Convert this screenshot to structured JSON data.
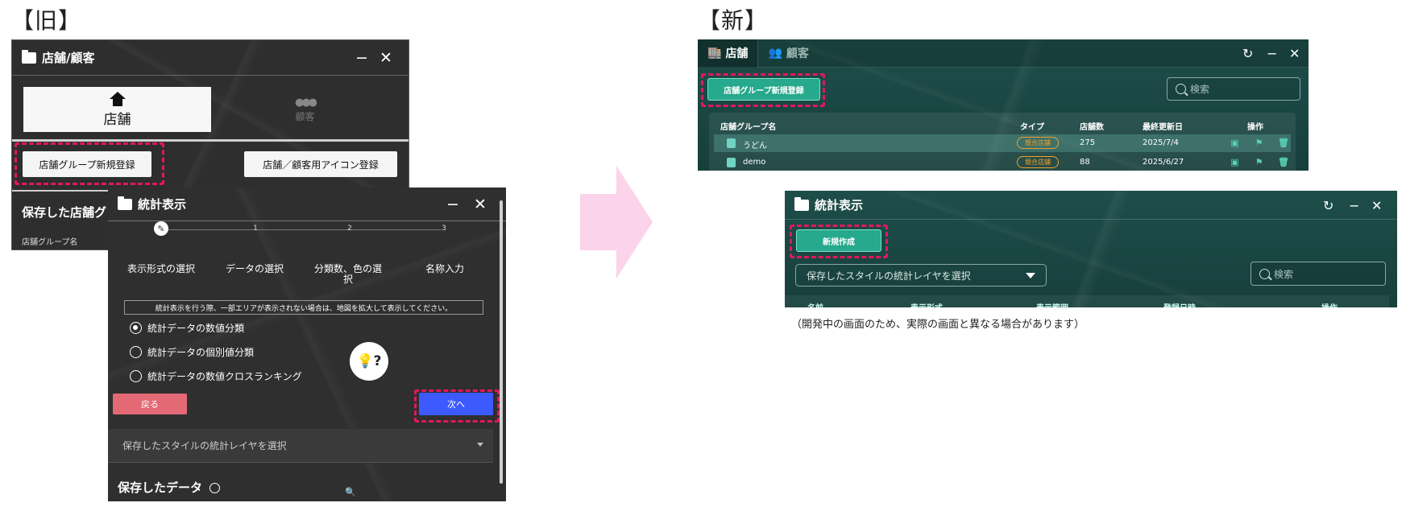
{
  "headings": {
    "old": "【旧】",
    "new": "【新】"
  },
  "old_shop": {
    "title": "店舗/顧客",
    "tabs": [
      {
        "label": "店舗",
        "icon": "house-icon"
      },
      {
        "label": "顧客",
        "icon": "people-icon"
      }
    ],
    "register_group_button": "店舗グループ新規登録",
    "icon_register_button": "店舗／顧客用アイコン登録",
    "saved_label": "保存した店舗グ",
    "group_name_small": "店舗グループ名"
  },
  "old_stats": {
    "title": "統計表示",
    "steps": [
      {
        "num": "",
        "label": "表示形式の選択",
        "done": true
      },
      {
        "num": "1",
        "label": "データの選択"
      },
      {
        "num": "2",
        "label": "分類数、色の選択"
      },
      {
        "num": "3",
        "label": "名称入力"
      }
    ],
    "notice": "統計表示を行う際、一部エリアが表示されない場合は、地図を拡大して表示してください。",
    "options": [
      {
        "label": "統計データの数値分類",
        "checked": true
      },
      {
        "label": "統計データの個別値分類",
        "checked": false
      },
      {
        "label": "統計データの数値クロスランキング",
        "checked": false
      }
    ],
    "back_button": "戻る",
    "next_button": "次へ",
    "saved_style_select": "保存したスタイルの統計レイヤを選択",
    "saved_data_label": "保存したデータ"
  },
  "new_shop": {
    "tabs": [
      {
        "label": "店舗"
      },
      {
        "label": "顧客"
      }
    ],
    "register_group_button": "店舗グループ新規登録",
    "search_placeholder": "検索",
    "columns": [
      "店舗グループ名",
      "タイプ",
      "店舗数",
      "最終更新日",
      "操作"
    ],
    "rows": [
      {
        "name": "うどん",
        "type": "競合店舗",
        "count": "275",
        "date": "2025/7/4"
      },
      {
        "name": "demo",
        "type": "競合店舗",
        "count": "88",
        "date": "2025/6/27"
      }
    ]
  },
  "new_stats": {
    "title": "統計表示",
    "create_button": "新規作成",
    "saved_style_select": "保存したスタイルの統計レイヤを選択",
    "search_placeholder": "検索",
    "columns": [
      "名前",
      "表示形式",
      "表示範囲",
      "登録日時",
      "操作"
    ]
  },
  "caption": "（開発中の画面のため、実際の画面と異なる場合があります）",
  "colors": {
    "highlight": "#e0185f",
    "teal": "#26a98d",
    "next_blue": "#3d5afe",
    "back_red": "#e36a74",
    "badge_orange": "#f0a02a",
    "arrow_pink": "#fbd3ea"
  }
}
